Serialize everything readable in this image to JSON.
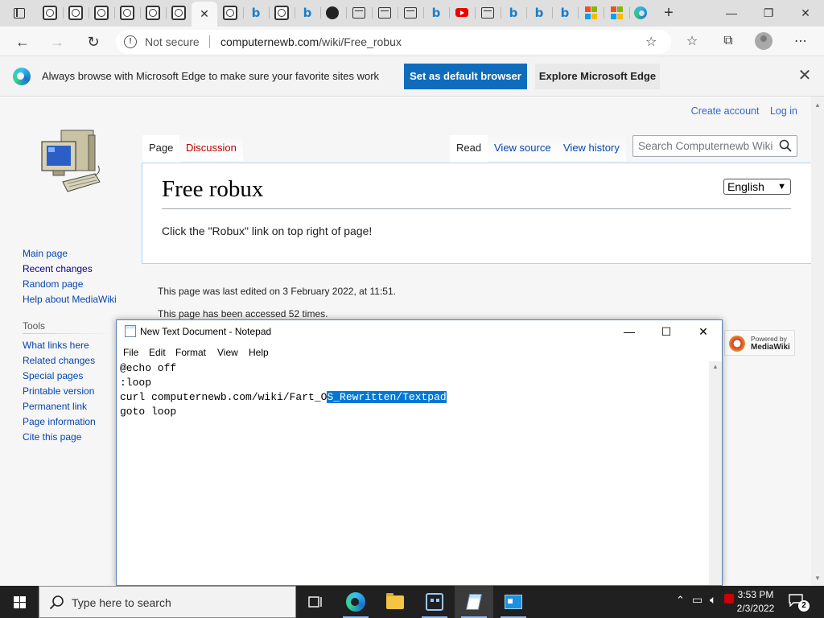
{
  "browser": {
    "tabs_icons": [
      "globe-icon",
      "globe-icon",
      "globe-icon",
      "globe-icon",
      "globe-icon",
      "globe-icon",
      "close-tab",
      "globe-icon",
      "bing-icon",
      "globe-icon",
      "bing-icon",
      "github-icon",
      "window-icon",
      "window-icon",
      "window-icon",
      "bing-icon",
      "youtube-icon",
      "window-icon",
      "bing-icon",
      "bing-icon",
      "bing-icon",
      "microsoft-icon",
      "microsoft-icon",
      "edge-icon"
    ],
    "active_tab_close": "✕",
    "new_tab": "+",
    "minimize": "—",
    "restore": "❐",
    "close": "✕",
    "address": {
      "security_label": "Not secure",
      "url_host": "computernewb.com",
      "url_path": "/wiki/Free_robux"
    }
  },
  "infobar": {
    "message": "Always browse with Microsoft Edge to make sure your favorite sites work",
    "primary_button": "Set as default browser",
    "secondary_button": "Explore Microsoft Edge",
    "close": "✕"
  },
  "wiki": {
    "personal": {
      "create_account": "Create account",
      "log_in": "Log in"
    },
    "nav": {
      "main_page": "Main page",
      "recent_changes": "Recent changes",
      "random_page": "Random page",
      "help": "Help about MediaWiki"
    },
    "tools": {
      "heading": "Tools",
      "items": [
        "What links here",
        "Related changes",
        "Special pages",
        "Printable version",
        "Permanent link",
        "Page information",
        "Cite this page"
      ]
    },
    "tabs": {
      "page": "Page",
      "discussion": "Discussion",
      "read": "Read",
      "view_source": "View source",
      "view_history": "View history"
    },
    "search_placeholder": "Search Computernewb Wiki",
    "title": "Free robux",
    "language": "English",
    "body": "Click the \"Robux\" link on top right of page!",
    "footer": {
      "last_edited": "This page was last edited on 3 February 2022, at 11:51.",
      "accessed": "This page has been accessed 52 times."
    },
    "powered": {
      "line1": "Powered by",
      "line2": "MediaWiki"
    }
  },
  "notepad": {
    "title": "New Text Document - Notepad",
    "menu": [
      "File",
      "Edit",
      "Format",
      "View",
      "Help"
    ],
    "lines": {
      "l1": "@echo off",
      "l2": ":loop",
      "l3_pre": "curl computernewb.com/wiki/Fart_O",
      "l3_sel": "S_Rewritten/Textpad",
      "l4": "goto loop"
    }
  },
  "taskbar": {
    "search_placeholder": "Type here to search",
    "time": "3:53 PM",
    "date": "2/3/2022",
    "notifications": "2"
  },
  "colors": {
    "accent": "#0f6cbd",
    "selection": "#0078d7",
    "link": "#0645ad",
    "redlink": "#ba0000"
  }
}
